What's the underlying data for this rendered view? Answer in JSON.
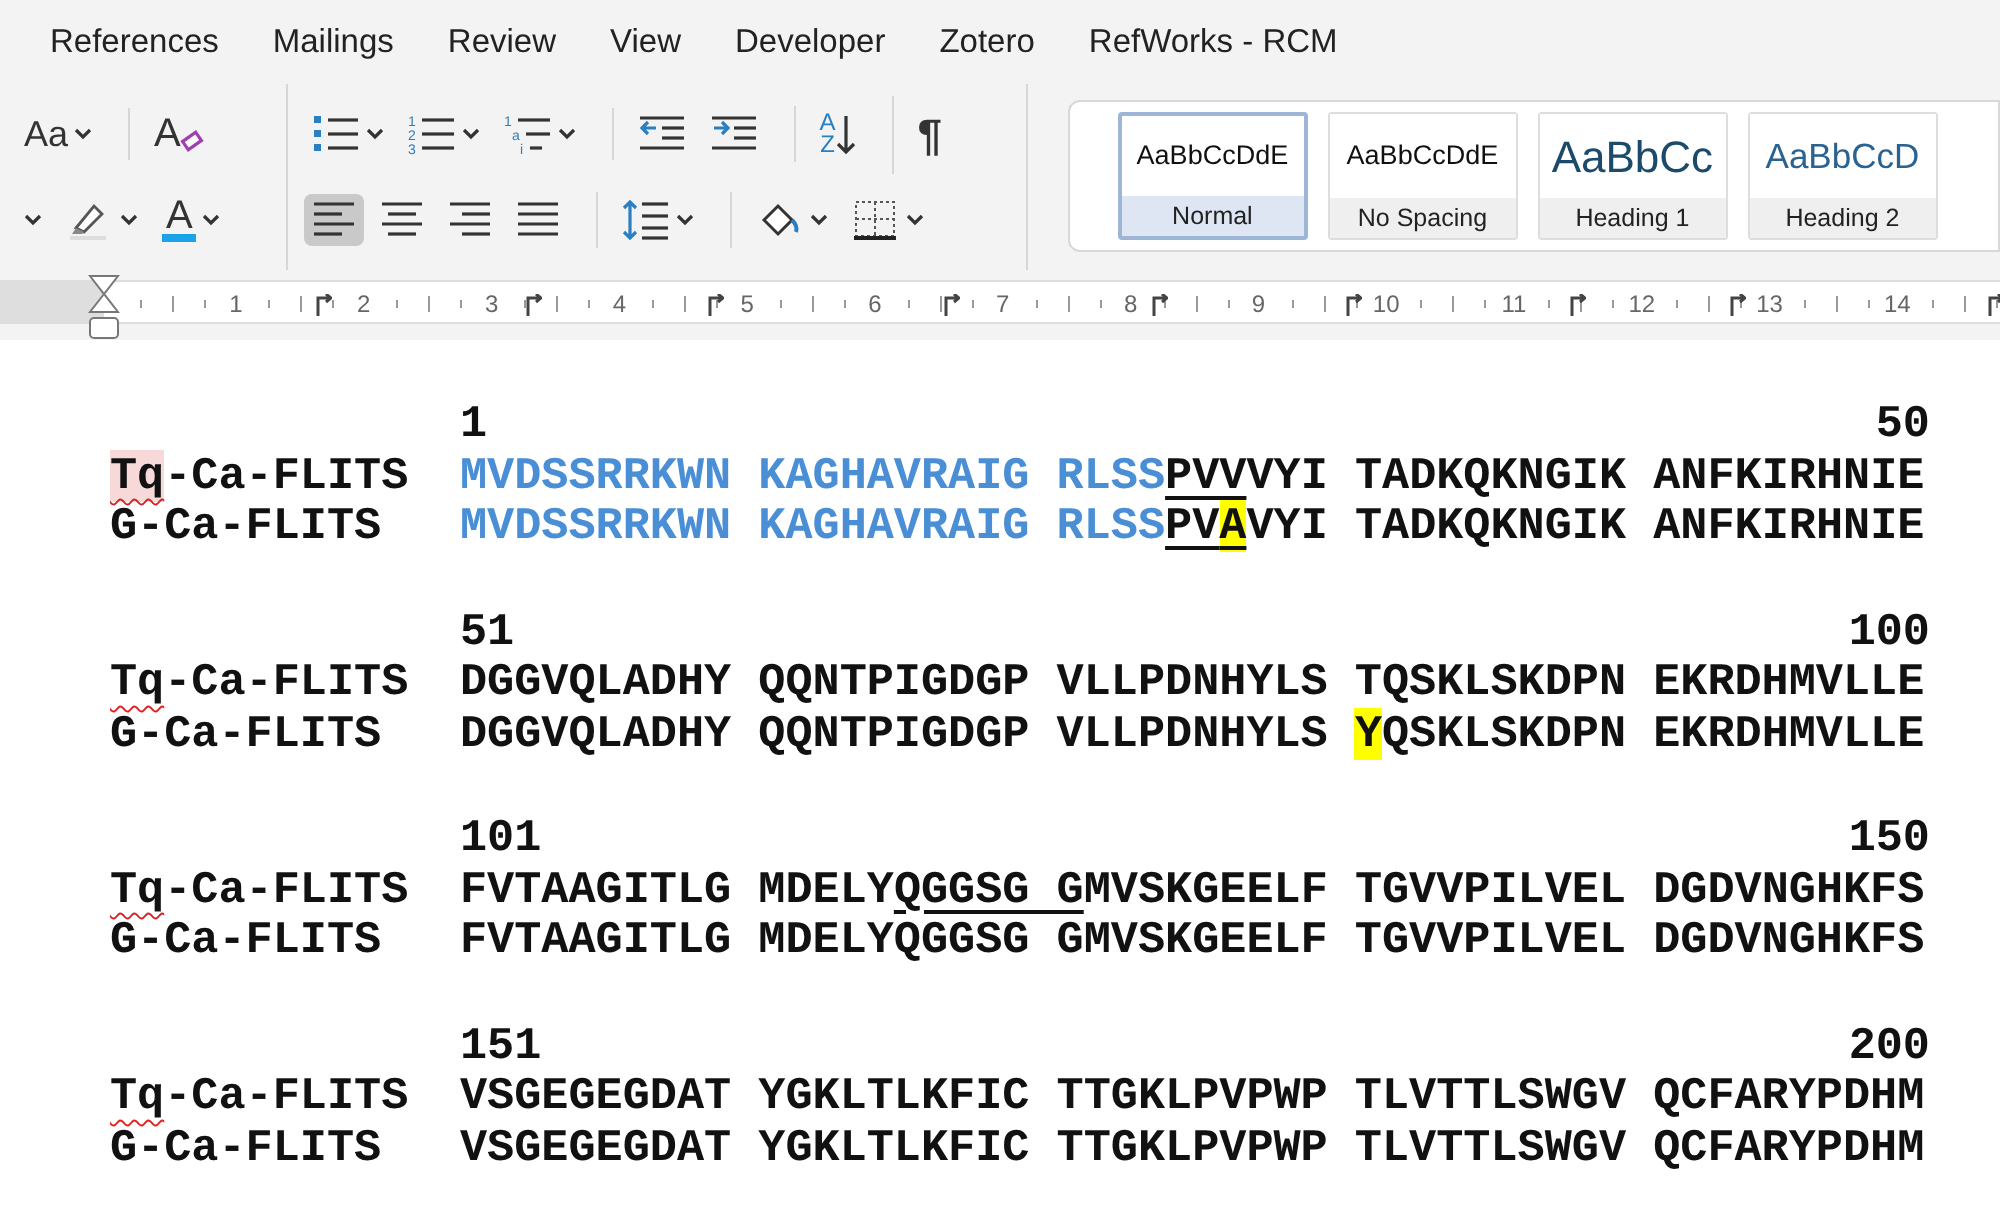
{
  "ribbon_tabs": [
    "References",
    "Mailings",
    "Review",
    "View",
    "Developer",
    "Zotero",
    "RefWorks - RCM"
  ],
  "toolbar": {
    "sections": [
      {
        "rows": [
          [
            [
              {
                "kind": "change_case",
                "label": "Aa",
                "dropdown": true
              }
            ],
            [
              {
                "kind": "clear_formatting",
                "label": "A",
                "dropdown": false
              }
            ]
          ],
          [
            [
              {
                "kind": "partial",
                "dropdown": true
              },
              {
                "kind": "highlight",
                "dropdown": true
              },
              {
                "kind": "font_color",
                "label": "A",
                "dropdown": true
              }
            ]
          ]
        ]
      },
      {
        "rows": [
          [
            [
              {
                "kind": "bullets",
                "dropdown": true
              },
              {
                "kind": "numbering",
                "markers": [
                  "1",
                  "2",
                  "3"
                ],
                "dropdown": true
              },
              {
                "kind": "multilevel",
                "markers": [
                  "1",
                  "a",
                  "i"
                ],
                "dropdown": true
              }
            ],
            [
              {
                "kind": "decrease_indent",
                "dropdown": false
              },
              {
                "kind": "increase_indent",
                "dropdown": false
              }
            ],
            [
              {
                "kind": "sort",
                "label": "AZ",
                "dropdown": false
              }
            ],
            [
              {
                "kind": "show_marks",
                "label": "¶",
                "dropdown": false
              }
            ]
          ],
          [
            [
              {
                "kind": "align_left",
                "dropdown": false,
                "selected": true
              },
              {
                "kind": "align_center",
                "dropdown": false,
                "selected": false
              },
              {
                "kind": "align_right",
                "dropdown": false,
                "selected": false
              },
              {
                "kind": "justify",
                "dropdown": false,
                "selected": false
              }
            ],
            [
              {
                "kind": "line_spacing",
                "dropdown": true
              }
            ],
            [
              {
                "kind": "shading",
                "dropdown": true
              },
              {
                "kind": "borders",
                "dropdown": true
              }
            ]
          ]
        ]
      }
    ]
  },
  "styles": [
    {
      "kind": "body",
      "preview": "AaBbCcDdE",
      "label": "Normal",
      "selected": true
    },
    {
      "kind": "body",
      "preview": "AaBbCcDdE",
      "label": "No Spacing",
      "selected": false
    },
    {
      "kind": "heading1",
      "preview": "AaBbCc",
      "label": "Heading 1",
      "selected": false
    },
    {
      "kind": "heading2",
      "preview": "AaBbCcD",
      "label": "Heading 2",
      "selected": false
    }
  ],
  "ruler": {
    "numbers": [
      "1",
      "2",
      "3",
      "4",
      "5",
      "6",
      "7",
      "8",
      "9",
      "10",
      "11",
      "12",
      "13",
      "14"
    ]
  },
  "alignment": {
    "blocks": [
      {
        "start": "1",
        "end": "50",
        "rows": [
          {
            "name": [
              {
                "text": "Tq",
                "spelling_error": true,
                "highlight": true
              },
              {
                "text": "-Ca-FLITS",
                "spelling_error": false,
                "highlight": false
              }
            ],
            "sequence": [
              {
                "text": "MVDSSRRKWN KAGHAVRAIG RLSS",
                "blue": true,
                "underline": false,
                "highlight": false
              },
              {
                "text": "PVV",
                "blue": false,
                "underline": true,
                "highlight": false
              },
              {
                "text": "VYI TADKQKNGIK ANFKIRHNIE",
                "blue": false,
                "underline": false,
                "highlight": false
              }
            ]
          },
          {
            "name": [
              {
                "text": "G-Ca-FLITS",
                "spelling_error": false,
                "highlight": false
              }
            ],
            "sequence": [
              {
                "text": "MVDSSRRKWN KAGHAVRAIG RLSS",
                "blue": true,
                "underline": false,
                "highlight": false
              },
              {
                "text": "PV",
                "blue": false,
                "underline": true,
                "highlight": false
              },
              {
                "text": "A",
                "blue": false,
                "underline": true,
                "highlight": true
              },
              {
                "text": "VYI TADKQKNGIK ANFKIRHNIE",
                "blue": false,
                "underline": false,
                "highlight": false
              }
            ]
          }
        ]
      },
      {
        "start": "51",
        "end": "100",
        "rows": [
          {
            "name": [
              {
                "text": "Tq",
                "spelling_error": true,
                "highlight": false
              },
              {
                "text": "-Ca-FLITS",
                "spelling_error": false,
                "highlight": false
              }
            ],
            "sequence": [
              {
                "text": "DGGVQLADHY QQNTPIGDGP VLLPDNHYLS TQSKLSKDPN EKRDHMVLLE",
                "blue": false,
                "underline": false,
                "highlight": false
              }
            ]
          },
          {
            "name": [
              {
                "text": "G-Ca-FLITS",
                "spelling_error": false,
                "highlight": false
              }
            ],
            "sequence": [
              {
                "text": "DGGVQLADHY QQNTPIGDGP VLLPDNHYLS ",
                "blue": false,
                "underline": false,
                "highlight": false
              },
              {
                "text": "Y",
                "blue": false,
                "underline": false,
                "highlight": true
              },
              {
                "text": "QSKLSKDPN EKRDHMVLLE",
                "blue": false,
                "underline": false,
                "highlight": false
              }
            ]
          }
        ]
      },
      {
        "start": "101",
        "end": "150",
        "rows": [
          {
            "name": [
              {
                "text": "Tq",
                "spelling_error": true,
                "highlight": false
              },
              {
                "text": "-Ca-FLITS",
                "spelling_error": false,
                "highlight": false
              }
            ],
            "sequence": [
              {
                "text": "FVTAAGITLG MDELY",
                "blue": false,
                "underline": false,
                "highlight": false
              },
              {
                "text": "QGGSG G",
                "blue": false,
                "underline": true,
                "highlight": false
              },
              {
                "text": "MVSKGEELF TGVVPILVEL DGDVNGHKFS",
                "blue": false,
                "underline": false,
                "highlight": false
              }
            ]
          },
          {
            "name": [
              {
                "text": "G-Ca-FLITS",
                "spelling_error": false,
                "highlight": false
              }
            ],
            "sequence": [
              {
                "text": "FVTAAGITLG MDELYQGGSG GMVSKGEELF TGVVPILVEL DGDVNGHKFS",
                "blue": false,
                "underline": false,
                "highlight": false
              }
            ]
          }
        ]
      },
      {
        "start": "151",
        "end": "200",
        "rows": [
          {
            "name": [
              {
                "text": "Tq",
                "spelling_error": true,
                "highlight": false
              },
              {
                "text": "-Ca-FLITS",
                "spelling_error": false,
                "highlight": false
              }
            ],
            "sequence": [
              {
                "text": "VSGEGEGDAT YGKLTLKFIC TTGKLPVPWP TLVTTLSWGV QCFARYPDHM",
                "blue": false,
                "underline": false,
                "highlight": false
              }
            ]
          },
          {
            "name": [
              {
                "text": "G-Ca-FLITS",
                "spelling_error": false,
                "highlight": false
              }
            ],
            "sequence": [
              {
                "text": "VSGEGEGDAT YGKLTLKFIC TTGKLPVPWP TLVTTLSWGV QCFARYPDHM",
                "blue": false,
                "underline": false,
                "highlight": false
              }
            ]
          }
        ]
      }
    ]
  }
}
